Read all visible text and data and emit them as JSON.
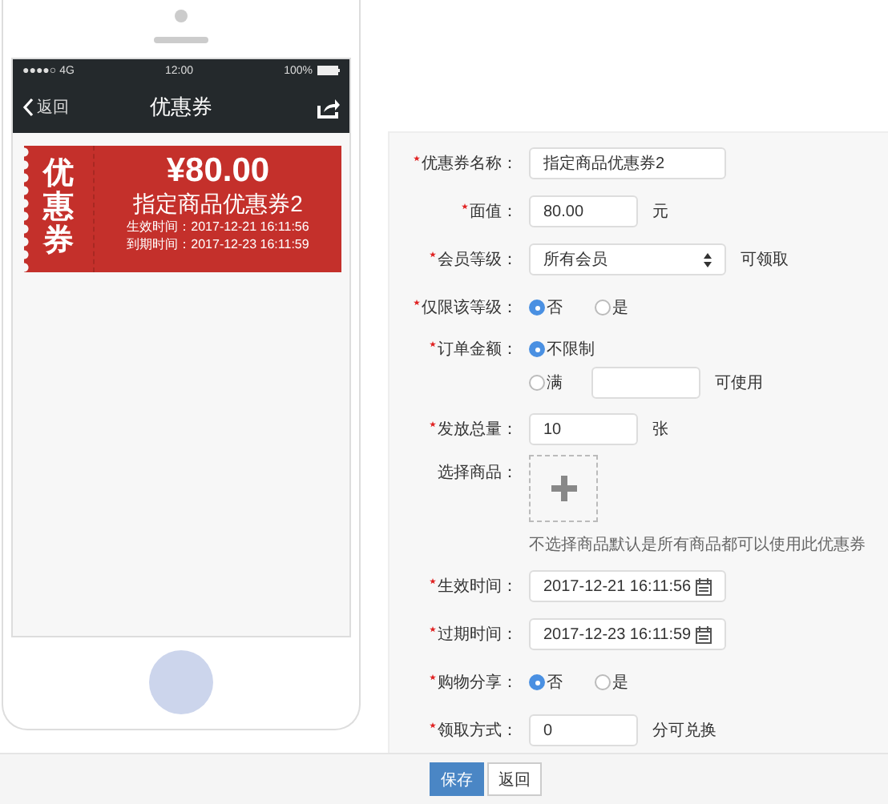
{
  "phone": {
    "status_bar": {
      "carrier": "●●●●○ 4G",
      "time": "12:00",
      "battery": "100%"
    },
    "nav": {
      "back": "返回",
      "title": "优惠券"
    },
    "coupon": {
      "badge": "优惠券",
      "amount": "¥80.00",
      "name": "指定商品优惠券2",
      "start": "生效时间：2017-12-21 16:11:56",
      "end": "到期时间：2017-12-23 16:11:59"
    }
  },
  "form": {
    "rows": [
      {
        "kind": "text",
        "required": true,
        "label": "优惠券名称：",
        "value": "指定商品优惠券2"
      },
      {
        "kind": "text",
        "required": true,
        "label": "面值：",
        "value": "80.00",
        "suffix": "元"
      },
      {
        "kind": "select",
        "required": true,
        "label": "会员等级：",
        "value": "所有会员",
        "suffix": "可领取"
      },
      {
        "kind": "radio",
        "required": true,
        "label": "仅限该等级：",
        "options": [
          {
            "label": "否",
            "selected": true
          },
          {
            "label": "是",
            "selected": false
          }
        ]
      },
      {
        "kind": "amount",
        "required": true,
        "label": "订单金额：",
        "options": [
          {
            "label": "不限制",
            "selected": true
          },
          {
            "label": "满",
            "selected": false
          }
        ],
        "suffix": "可使用"
      },
      {
        "kind": "text",
        "required": true,
        "label": "发放总量：",
        "value": "10",
        "suffix": "张"
      },
      {
        "kind": "upload",
        "required": false,
        "label": "选择商品：",
        "hint": "不选择商品默认是所有商品都可以使用此优惠券"
      },
      {
        "kind": "date",
        "required": true,
        "label": "生效时间：",
        "value": "2017-12-21 16:11:56"
      },
      {
        "kind": "date",
        "required": true,
        "label": "过期时间：",
        "value": "2017-12-23 16:11:59"
      },
      {
        "kind": "radio",
        "required": true,
        "label": "购物分享：",
        "options": [
          {
            "label": "否",
            "selected": true
          },
          {
            "label": "是",
            "selected": false
          }
        ]
      },
      {
        "kind": "text",
        "required": true,
        "label": "领取方式：",
        "value": "0",
        "suffix": "分可兑换"
      }
    ]
  },
  "footer": {
    "buttons": [
      {
        "label": "保存",
        "kind": "primary"
      },
      {
        "label": "返回",
        "kind": "default"
      }
    ]
  }
}
